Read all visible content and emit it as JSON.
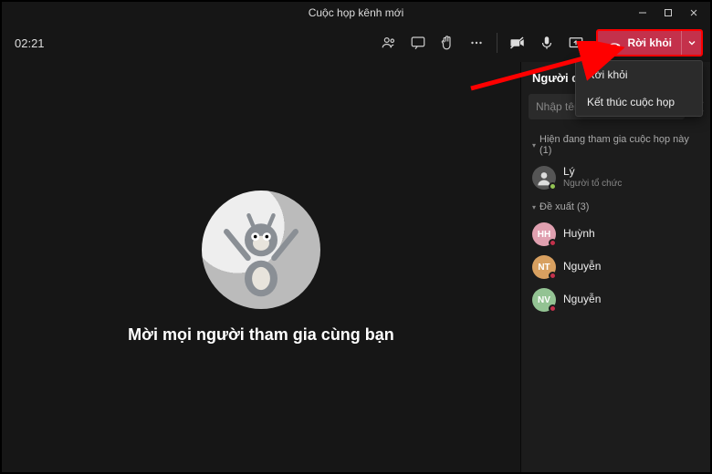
{
  "titlebar": {
    "title": "Cuộc họp kênh mới"
  },
  "toolbar": {
    "timer": "02:21",
    "leave_label": "Rời khỏi"
  },
  "leave_menu": {
    "items": [
      {
        "label": "Rời khỏi"
      },
      {
        "label": "Kết thúc cuộc họp"
      }
    ]
  },
  "stage": {
    "invite_text": "Mời mọi người tham gia cùng bạn"
  },
  "panel": {
    "title": "Người dự",
    "search_placeholder": "Nhập tên",
    "sections": {
      "in_meeting": {
        "label": "Hiện đang tham gia cuộc họp này (1)"
      },
      "suggested": {
        "label": "Đề xuất (3)"
      }
    },
    "in_meeting": [
      {
        "name": "Lý",
        "role": "Người tổ chức",
        "initials": "",
        "color": "#555",
        "presence": "#92c353",
        "img": true
      }
    ],
    "suggested": [
      {
        "name": "Huỳnh",
        "initials": "HH",
        "color": "#e0a0b0",
        "presence": "#c4314b"
      },
      {
        "name": "Nguyễn",
        "initials": "NT",
        "color": "#d8a060",
        "presence": "#c4314b"
      },
      {
        "name": "Nguyễn",
        "initials": "NV",
        "color": "#93c393",
        "presence": "#c4314b"
      }
    ]
  },
  "colors": {
    "leave_bg": "#c4314b",
    "highlight": "#ff0000"
  }
}
